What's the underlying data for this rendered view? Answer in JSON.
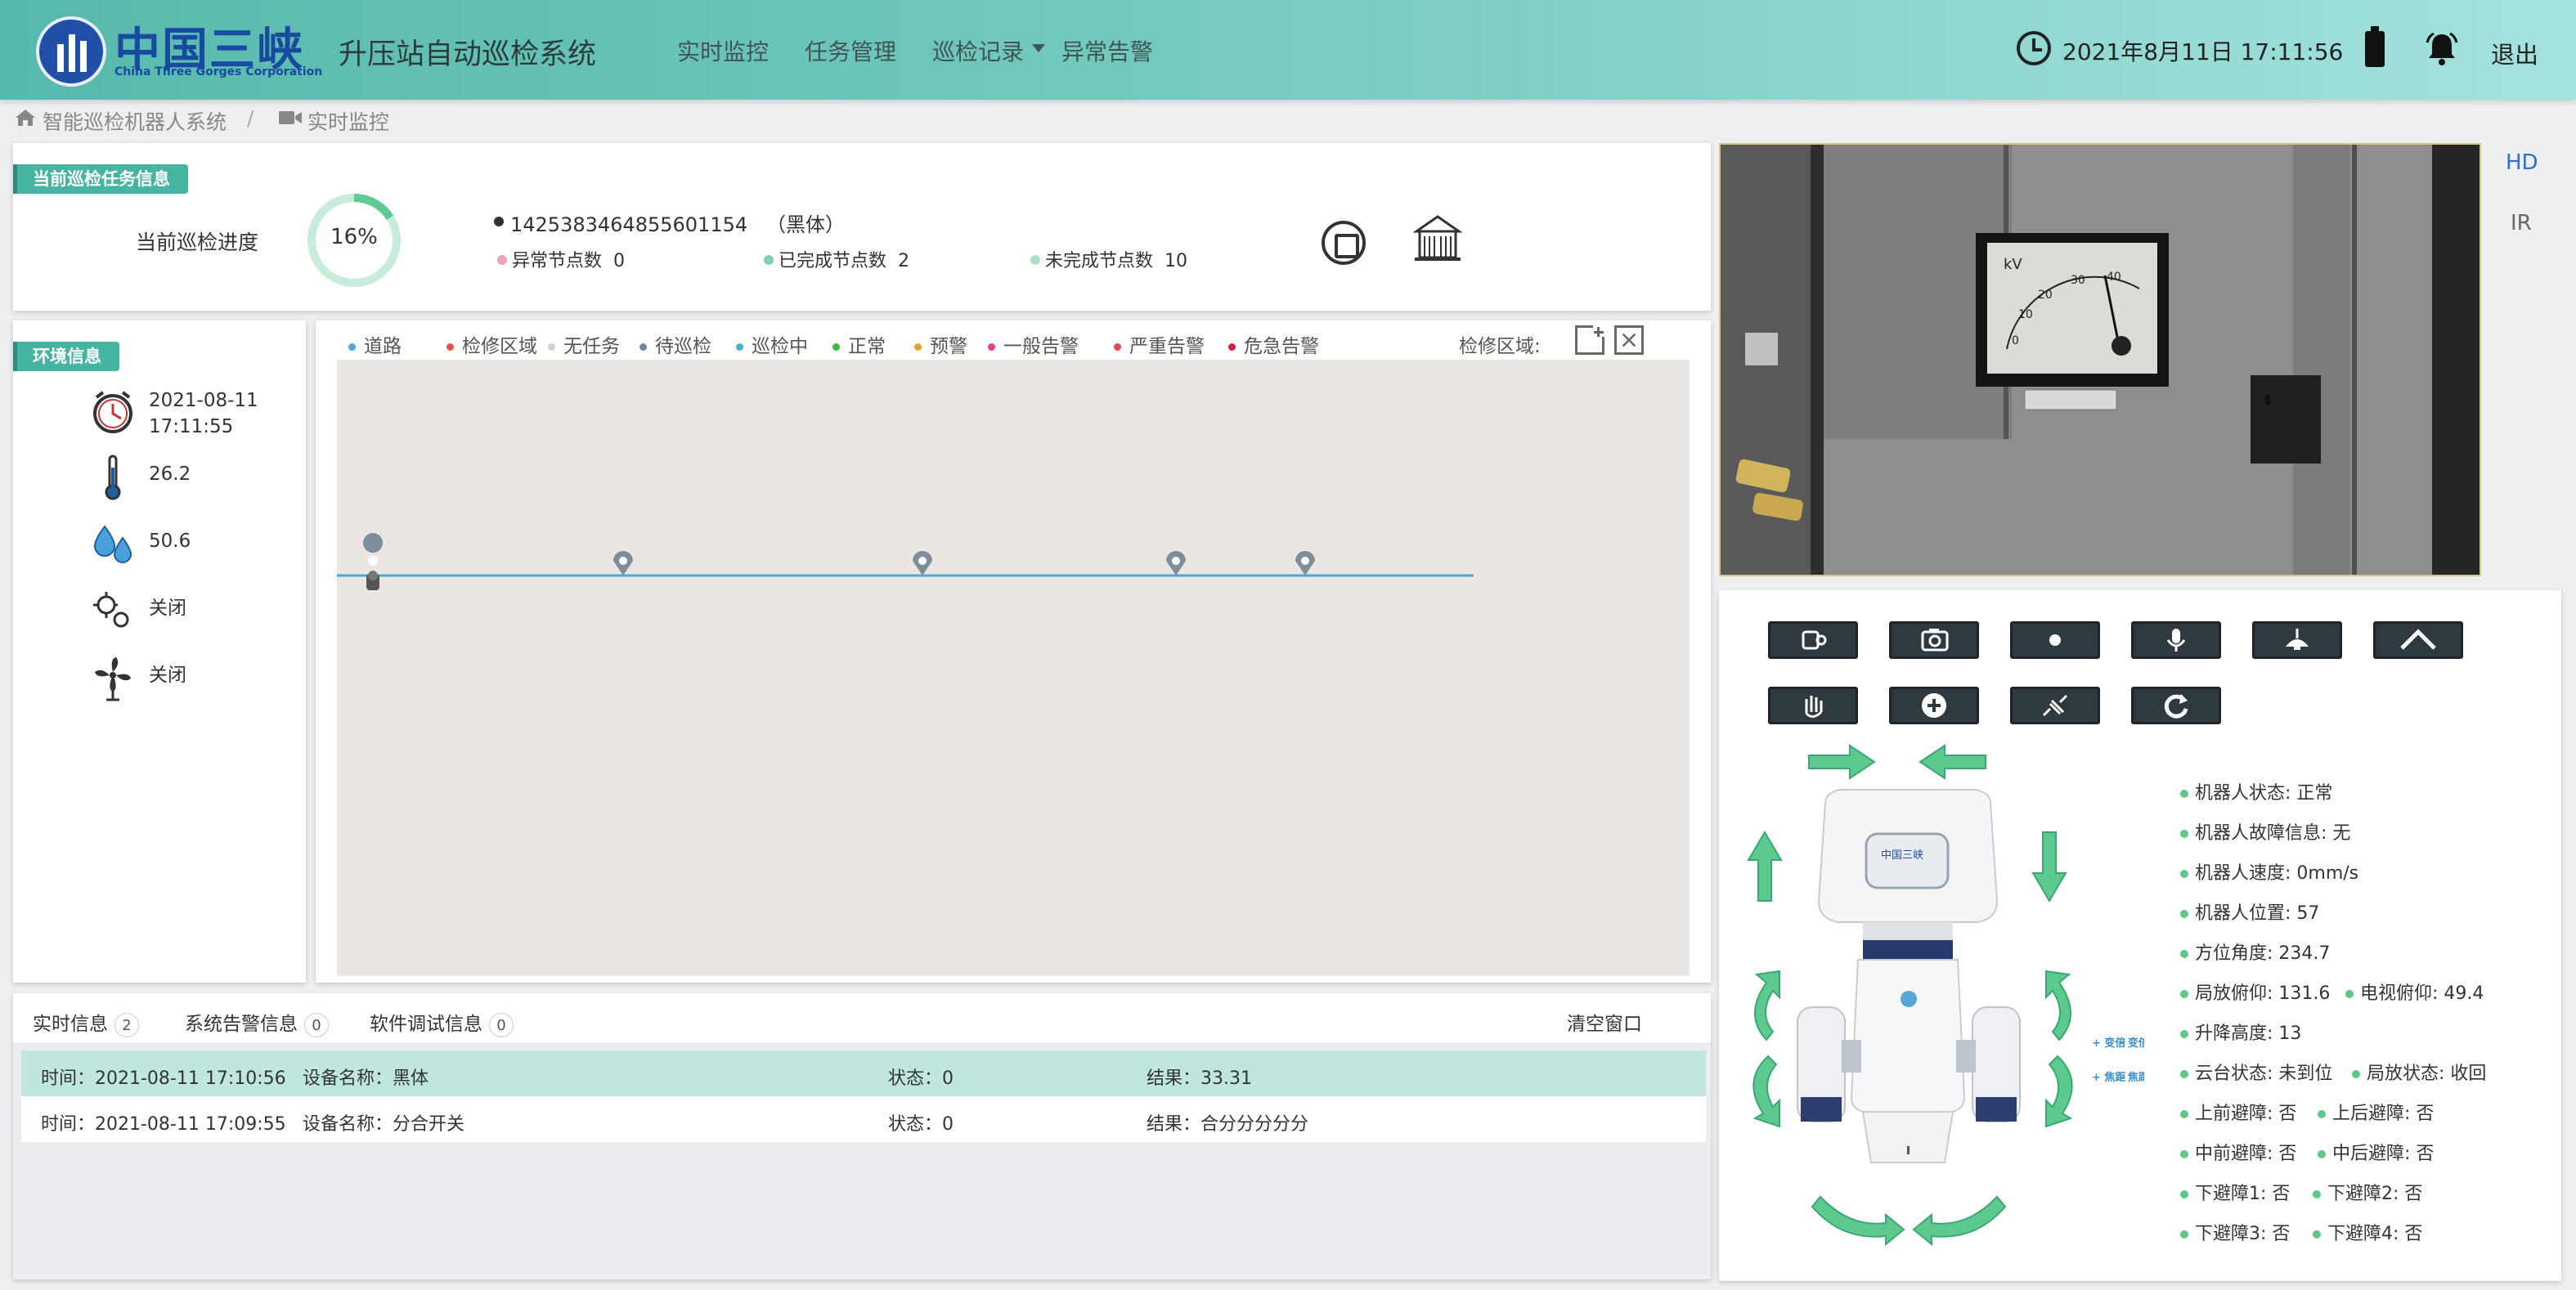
{
  "header": {
    "logo_cn": "中国三峡",
    "logo_en": "China Three Gorges Corporation",
    "title": "升压站自动巡检系统",
    "nav": [
      "实时监控",
      "任务管理",
      "巡检记录",
      "异常告警"
    ],
    "datetime": "2021年8月11日 17:11:56",
    "logout": "退出"
  },
  "breadcrumb": [
    "智能巡检机器人系统",
    "/",
    "实时监控"
  ],
  "task": {
    "tag": "当前巡检任务信息",
    "progress_label": "当前巡检进度",
    "progress_text": "16%",
    "progress": 0.16,
    "task_id": "1425383464855601154",
    "task_name": "（黑体）",
    "abnormal_label": "异常节点数",
    "abnormal_value": "0",
    "done_label": "已完成节点数",
    "done_value": "2",
    "undone_label": "未完成节点数",
    "undone_value": "10"
  },
  "env": {
    "tag": "环境信息",
    "date": "2021-08-11",
    "time": "17:11:55",
    "temperature": "26.2",
    "humidity": "50.6",
    "device1": "关闭",
    "device2": "关闭"
  },
  "map": {
    "legend": [
      {
        "label": "道路",
        "color": "#4aa8d8"
      },
      {
        "label": "检修区域",
        "color": "#e0574a"
      },
      {
        "label": "无任务",
        "color": "#cfcfcf"
      },
      {
        "label": "待巡检",
        "color": "#6b8b9a"
      },
      {
        "label": "巡检中",
        "color": "#45b2cc"
      },
      {
        "label": "正常",
        "color": "#3cb84a"
      },
      {
        "label": "预警",
        "color": "#e2a12c"
      },
      {
        "label": "一般告警",
        "color": "#e53e8c"
      },
      {
        "label": "严重告警",
        "color": "#e24e4e"
      },
      {
        "label": "危急告警",
        "color": "#d6203a"
      }
    ],
    "maintenance_label": "检修区域:"
  },
  "log": {
    "tabs": [
      {
        "label": "实时信息",
        "count": "2"
      },
      {
        "label": "系统告警信息",
        "count": "0"
      },
      {
        "label": "软件调试信息",
        "count": "0"
      }
    ],
    "clear": "清空窗口",
    "rows": [
      {
        "time": "时间：2021-08-11 17:10:56",
        "device": "设备名称：黑体",
        "state": "状态：0",
        "result": "结果：33.31"
      },
      {
        "time": "时间：2021-08-11 17:09:55",
        "device": "设备名称：分合开关",
        "state": "状态：0",
        "result": "结果：合分分分分分"
      }
    ]
  },
  "camera": {
    "hd": "HD",
    "ir": "IR",
    "meter_unit": "kV",
    "meter_ticks": [
      "0",
      "10",
      "20",
      "30",
      "40"
    ]
  },
  "robot": {
    "focus_labels": [
      "+ 变倍",
      "- 变倍",
      "+ 焦距",
      "- 焦距"
    ],
    "body_logo": "中国三峡",
    "status": [
      "机器人状态: 正常",
      "机器人故障信息: 无",
      "机器人速度: 0mm/s",
      "机器人位置: 57",
      "方位角度: 234.7",
      "局放俯仰: 131.6",
      "电视俯仰: 49.4",
      "升降高度: 13",
      "云台状态: 未到位",
      "局放状态: 收回",
      "上前避障: 否",
      "上后避障: 否",
      "中前避障: 否",
      "中后避障: 否",
      "下避障1: 否",
      "下避障2: 否",
      "下避障3: 否",
      "下避障4: 否"
    ]
  }
}
